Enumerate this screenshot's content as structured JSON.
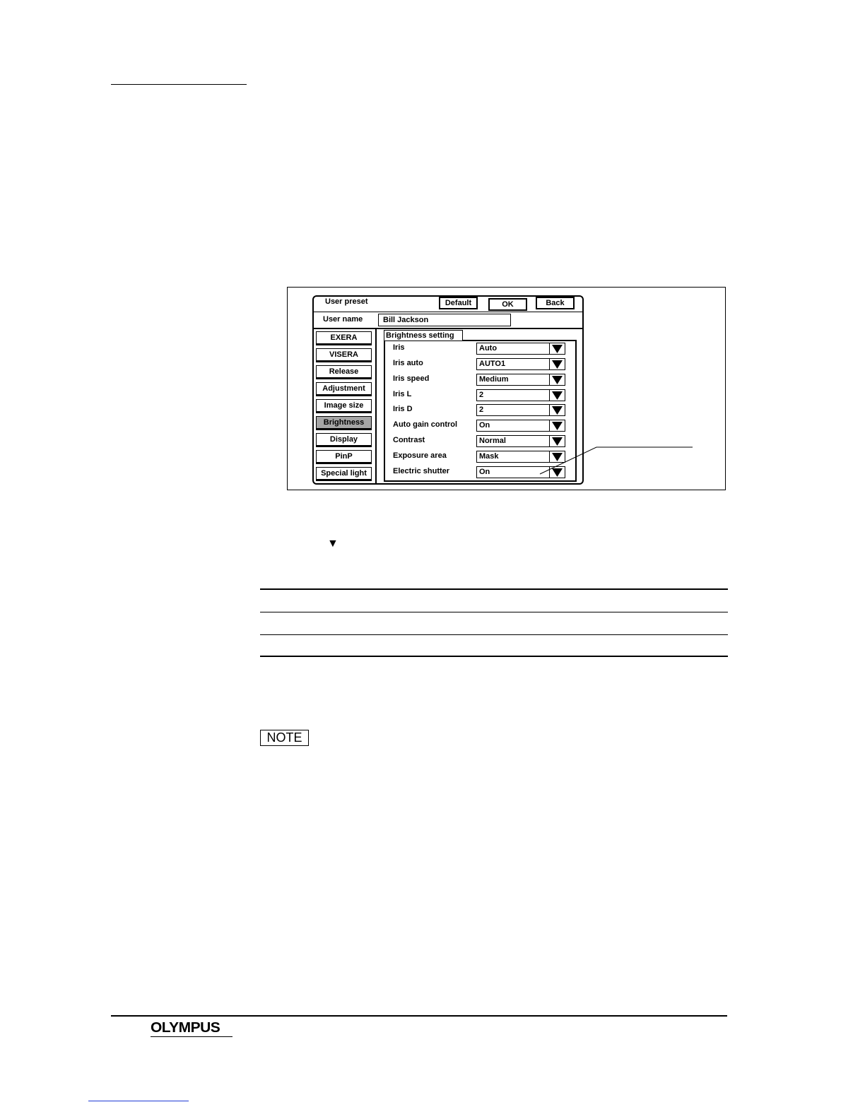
{
  "screen": {
    "title": "User preset",
    "buttons": {
      "default": "Default",
      "ok": "OK",
      "back": "Back"
    },
    "user_name_label": "User name",
    "user_name_value": "Bill Jackson",
    "sidebar": [
      "EXERA",
      "VISERA",
      "Release",
      "Adjustment",
      "Image size",
      "Brightness",
      "Display",
      "PinP",
      "Special light"
    ],
    "active_sidebar": "Brightness",
    "group_title": "Brightness setting",
    "settings": [
      {
        "label": "Iris",
        "value": "Auto"
      },
      {
        "label": "Iris auto",
        "value": "AUTO1"
      },
      {
        "label": "Iris speed",
        "value": "Medium"
      },
      {
        "label": "Iris L",
        "value": "2"
      },
      {
        "label": "Iris D",
        "value": "2"
      },
      {
        "label": "Auto gain control",
        "value": "On"
      },
      {
        "label": "Contrast",
        "value": "Normal"
      },
      {
        "label": "Exposure area",
        "value": "Mask"
      },
      {
        "label": "Electric shutter",
        "value": "On"
      }
    ]
  },
  "body": {
    "arrow_glyph": "▼",
    "note_label": "NOTE"
  },
  "footer": {
    "logo": "OLYMPUS"
  },
  "colors": {
    "active_tab": "#a6a6a6",
    "link_line": "#1f3bd6"
  }
}
